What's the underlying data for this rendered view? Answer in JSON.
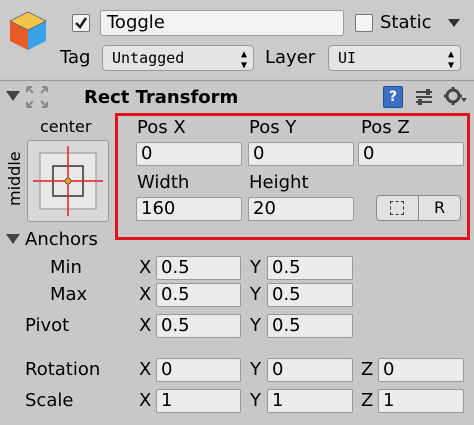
{
  "header": {
    "object_name": "Toggle",
    "active_checked": true,
    "static_label": "Static",
    "static_checked": false,
    "tag_label": "Tag",
    "tag_value": "Untagged",
    "layer_label": "Layer",
    "layer_value": "UI"
  },
  "component": {
    "title": "Rect Transform",
    "anchor_preset": {
      "horizontal": "center",
      "vertical": "middle"
    },
    "position": {
      "pos_x_label": "Pos X",
      "pos_y_label": "Pos Y",
      "pos_z_label": "Pos Z",
      "pos_x": "0",
      "pos_y": "0",
      "pos_z": "0"
    },
    "size": {
      "width_label": "Width",
      "height_label": "Height",
      "width": "160",
      "height": "20",
      "raw_edit_button": "R"
    },
    "anchors": {
      "label": "Anchors",
      "min_label": "Min",
      "min_x": "0.5",
      "min_y": "0.5",
      "max_label": "Max",
      "max_x": "0.5",
      "max_y": "0.5"
    },
    "pivot": {
      "label": "Pivot",
      "x": "0.5",
      "y": "0.5"
    },
    "rotation": {
      "label": "Rotation",
      "x": "0",
      "y": "0",
      "z": "0"
    },
    "scale": {
      "label": "Scale",
      "x": "1",
      "y": "1",
      "z": "1"
    },
    "axis_labels": {
      "x": "X",
      "y": "Y",
      "z": "Z"
    }
  },
  "colors": {
    "highlight_box": "#e0141e",
    "panel_bg": "#c8c8c8",
    "anchor_cross": "#e02020",
    "anchor_dot": "#e8a020",
    "help_icon": "#3a6fc4"
  },
  "icons": {
    "gameobject": "cube-icon",
    "component": "rect-transform-icon",
    "help": "help-book-icon",
    "presets": "presets-slider-icon",
    "settings": "gear-icon",
    "blueprint": "blueprint-mode-icon"
  }
}
